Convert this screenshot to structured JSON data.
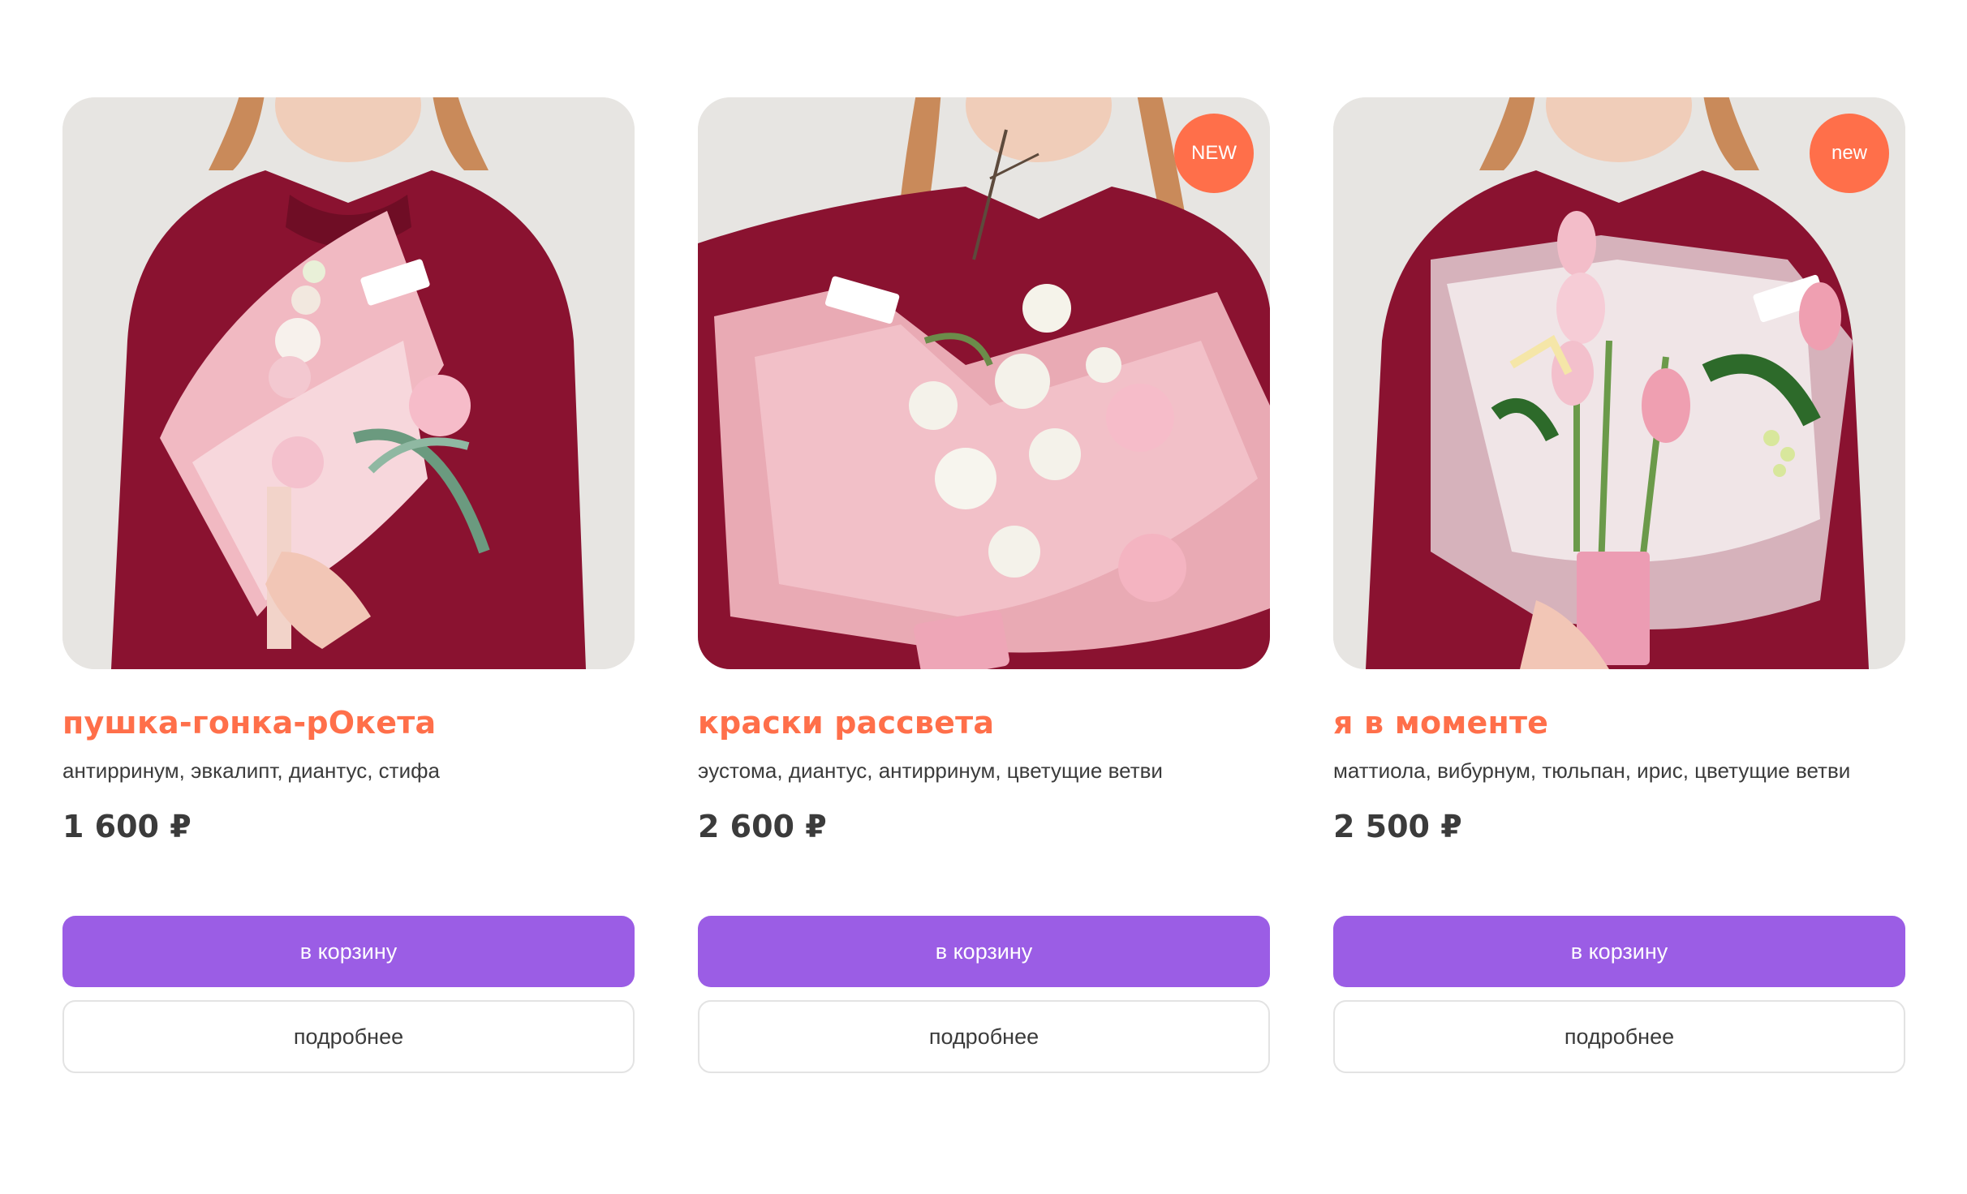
{
  "products": [
    {
      "title": "пушка-гонка-рОкета",
      "description": "антирринум, эвкалипт, диантус, стифа",
      "price": "1 600 ₽",
      "badge": "",
      "cart_label": "в корзину",
      "more_label": "подробнее"
    },
    {
      "title": "краски рассвета",
      "description": "эустома, диантус, антирринум, цветущие ветви",
      "price": "2 600 ₽",
      "badge": "NEW",
      "cart_label": "в корзину",
      "more_label": "подробнее"
    },
    {
      "title": "я в моменте",
      "description": "маттиола, вибурнум, тюльпан, ирис, цветущие ветви",
      "price": "2 500 ₽",
      "badge": "new",
      "cart_label": "в корзину",
      "more_label": "подробнее"
    }
  ],
  "colors": {
    "accent_title": "#ff6f4a",
    "badge": "#ff6f4a",
    "cart_button": "#9b5de5",
    "text": "#3b3b3b"
  }
}
